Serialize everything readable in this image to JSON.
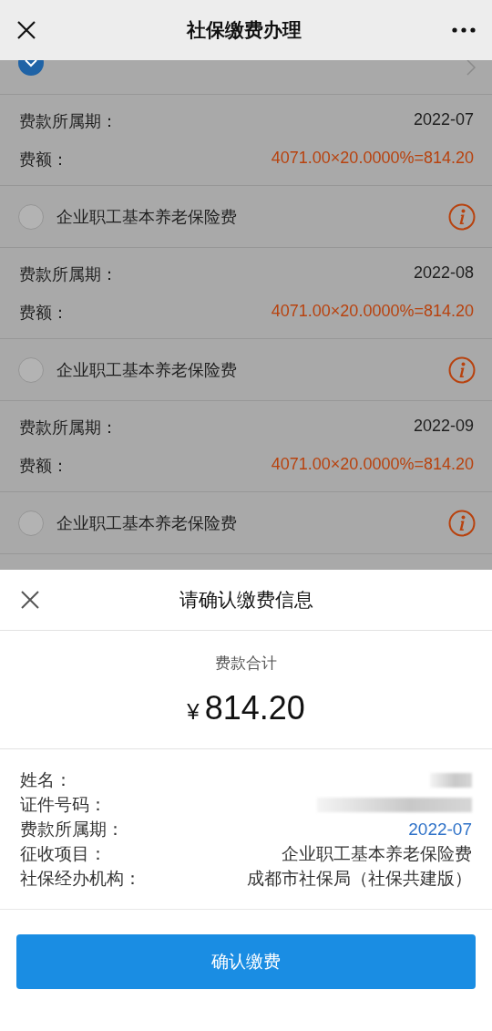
{
  "header": {
    "title": "社保缴费办理"
  },
  "items": [
    {
      "checked": true,
      "kind": "chevron",
      "period_label": "费款所属期：",
      "period": "2022-07",
      "amount_label": "费额：",
      "amount": "4071.00×20.0000%=814.20"
    },
    {
      "name": "企业职工基本养老保险费",
      "checked": false,
      "kind": "info",
      "period_label": "费款所属期：",
      "period": "2022-08",
      "amount_label": "费额：",
      "amount": "4071.00×20.0000%=814.20"
    },
    {
      "name": "企业职工基本养老保险费",
      "checked": false,
      "kind": "info",
      "period_label": "费款所属期：",
      "period": "2022-09",
      "amount_label": "费额：",
      "amount": "4071.00×20.0000%=814.20"
    },
    {
      "name": "企业职工基本养老保险费",
      "checked": false,
      "kind": "info"
    }
  ],
  "sheet": {
    "title": "请确认缴费信息",
    "total_label": "费款合计",
    "currency": "¥",
    "total": "814.20",
    "fields": [
      {
        "label": "姓名：",
        "kind": "redacted"
      },
      {
        "label": "证件号码：",
        "kind": "redacted"
      },
      {
        "label": "费款所属期：",
        "kind": "link",
        "value": "2022-07"
      },
      {
        "label": "征收项目：",
        "kind": "text",
        "value": "企业职工基本养老保险费"
      },
      {
        "label": "社保经办机构：",
        "kind": "text",
        "value": "成都市社保局（社保共建版）"
      }
    ],
    "confirm_button": "确认缴费"
  }
}
